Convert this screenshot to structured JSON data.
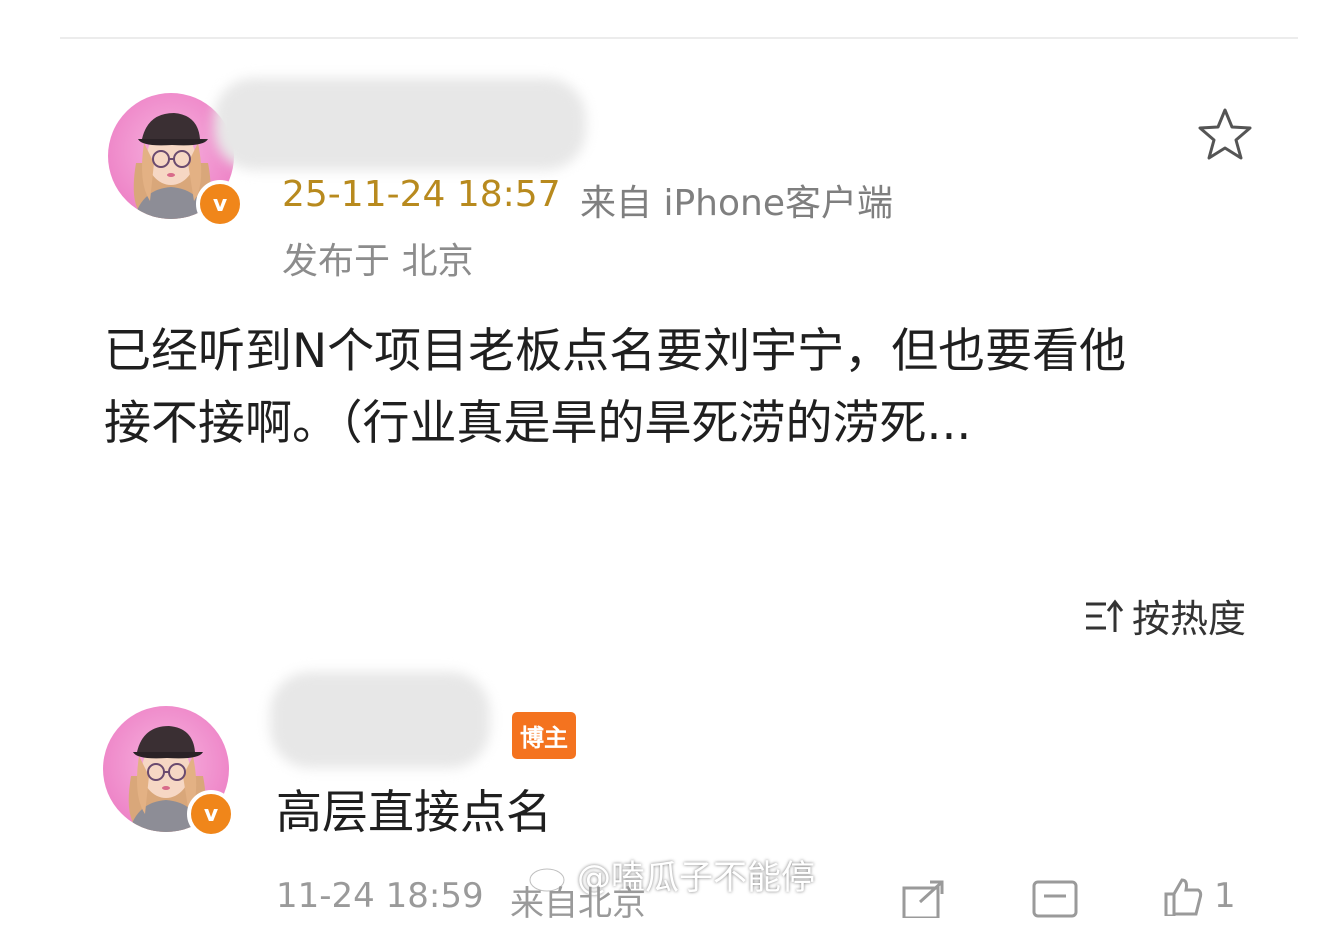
{
  "post": {
    "timestamp": "25-11-24 18:57",
    "source": "来自 iPhone客户端",
    "location": "发布于 北京",
    "text": "已经听到N个项目老板点名要刘宇宁，但也要看他\n接不接啊。（行业真是旱的旱死涝的涝死...",
    "verified_badge": "v"
  },
  "sort": {
    "label": "按热度"
  },
  "reply": {
    "host_tag": "博主",
    "text": "高层直接点名",
    "verified_badge": "v",
    "timestamp": "11-24 18:59",
    "source": "来自北京",
    "like_count": "1"
  },
  "watermark": {
    "text": "@嗑瓜子不能停"
  },
  "colors": {
    "accent": "#f0861a",
    "date": "#b88a1e",
    "host_badge": "#f4731f"
  },
  "icons": [
    "star-icon",
    "sort-icon",
    "weibo-logo-icon",
    "share-icon",
    "comment-icon",
    "like-icon"
  ]
}
